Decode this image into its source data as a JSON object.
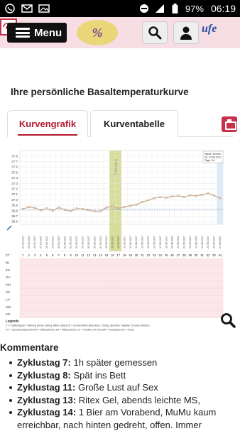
{
  "statusbar": {
    "battery": "97%",
    "time": "06:19"
  },
  "header": {
    "menu_label": "Menu"
  },
  "page": {
    "title": "Ihre persönliche Basaltemperaturkurve"
  },
  "tabs": [
    {
      "label": "Kurvengrafik",
      "active": true
    },
    {
      "label": "Kurventabelle",
      "active": false
    }
  ],
  "chart_data": {
    "type": "line",
    "y_ticks": [
      36.6,
      36.7,
      36.8,
      36.9,
      37.0,
      37.1,
      37.2,
      37.3,
      37.4,
      37.5,
      37.6,
      37.7,
      37.8
    ],
    "ylim": [
      36.55,
      37.9
    ],
    "coverline": 36.83,
    "ovulation_label": "Eisprung (8)",
    "info_lines": [
      "Name: Kerstin",
      "Zy: 23.04.2017",
      "Tage: 34"
    ],
    "x_dates": [
      "24.04.2017",
      "25.04.2017",
      "26.04.2017",
      "27.04.2017",
      "28.04.2017",
      "29.04.2017",
      "30.04.2017",
      "01.05.2017",
      "02.05.2017",
      "03.05.2017",
      "04.05.2017",
      "05.05.2017",
      "06.05.2017",
      "07.05.2017",
      "08.05.2017",
      "09.05.2017",
      "10.05.2017",
      "11.05.2017",
      "12.05.2017",
      "13.05.2017",
      "14.05.2017",
      "15.05.2017",
      "16.05.2017",
      "17.05.2017",
      "18.05.2017",
      "19.05.2017",
      "20.05.2017",
      "21.05.2017",
      "22.05.2017",
      "23.05.2017",
      "24.05.2017",
      "25.05.2017",
      "26.05.2017",
      "27.05.2017"
    ],
    "cycle_days": [
      1,
      2,
      3,
      4,
      5,
      6,
      7,
      8,
      9,
      10,
      11,
      12,
      13,
      14,
      15,
      16,
      17,
      18,
      19,
      20,
      21,
      22,
      23,
      24,
      25,
      26,
      27,
      28,
      29,
      30,
      31,
      32,
      33,
      34
    ],
    "series": [
      {
        "values": [
          36.83,
          36.87,
          36.85,
          36.81,
          36.84,
          36.8,
          36.86,
          36.82,
          36.79,
          36.84,
          36.83,
          36.81,
          36.79,
          36.79,
          36.86,
          36.88,
          36.84,
          36.87,
          36.89,
          36.91,
          36.96,
          36.99,
          37.03,
          37.05,
          37.04,
          37.06,
          37.07,
          37.05,
          37.08,
          37.07,
          37.09,
          37.12,
          37.08,
          37.03
        ]
      }
    ],
    "row_labels": [
      "ZT",
      "BL",
      "ZS",
      "GV",
      "MH",
      "SS",
      "LH",
      "SW",
      "KG"
    ],
    "grid": true
  },
  "legend": {
    "title": "Legende",
    "line1": "ZT = Zyklustag    BL = Blutung (Keine, Wenig, Mittel, Stark)    ZS = Zervixschleim (Beb.dend, Cremig, Spinnbar, Glasklar, Trocken, Menstr.)",
    "line2": "GV = Geschlechtsverkehr    MH = Mittelschmerz    SS = Mittelschmerz    LH = Positiver LH-Test    SW = Schwanger    KG = Krank"
  },
  "comments": {
    "title": "Kommentare",
    "items": [
      {
        "day": "Zyklustag 7:",
        "text": "1h später gemessen"
      },
      {
        "day": "Zyklustag 8:",
        "text": "Spät ins Bett"
      },
      {
        "day": "Zyklustag 11:",
        "text": "Große Lust auf Sex"
      },
      {
        "day": "Zyklustag 13:",
        "text": "Ritex Gel, abends leichte MS,"
      },
      {
        "day": "Zyklustag 14:",
        "text": "1 Bier am Vorabend, MuMu kaum erreichbar, nach hinten gedreht, offen. Immer"
      }
    ]
  },
  "colors": {
    "accent": "#b5182e",
    "header_bg": "#f7dde4",
    "curve": "#c9a98a",
    "ovulation_band": "#c9d27a"
  }
}
